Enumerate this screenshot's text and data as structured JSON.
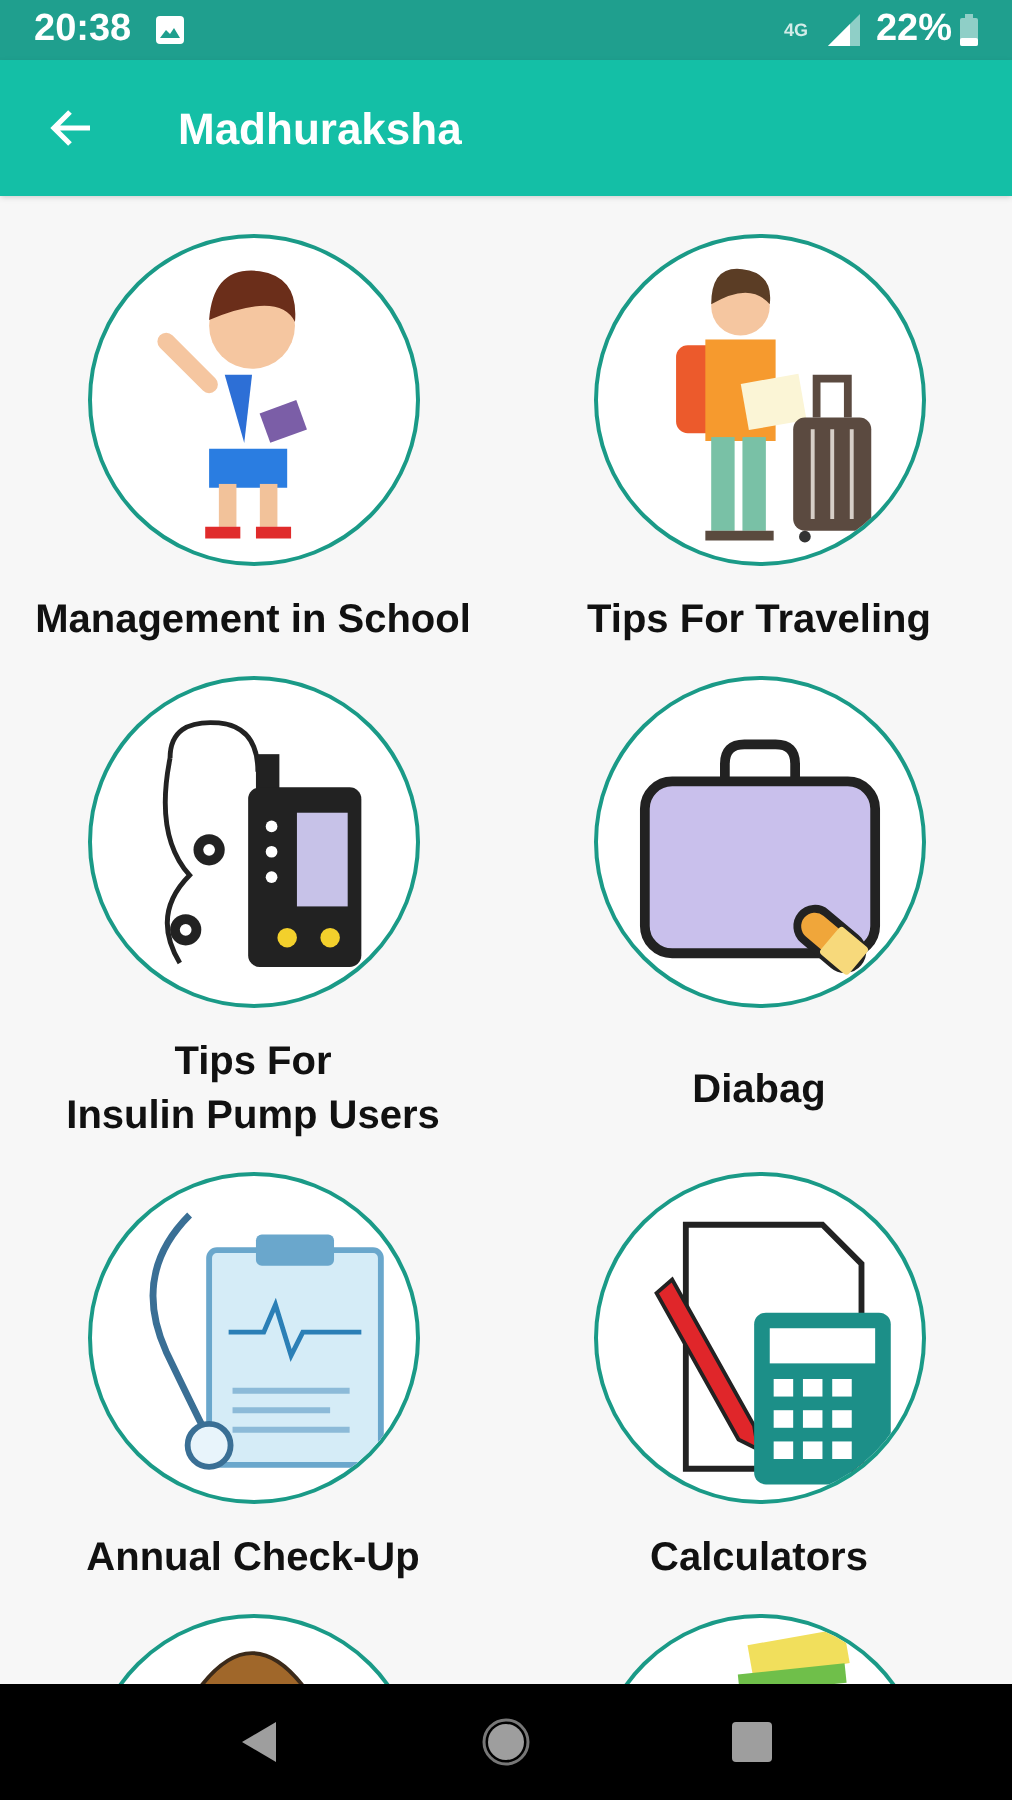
{
  "status_bar": {
    "time": "20:38",
    "network": "4G",
    "battery": "22%"
  },
  "app_bar": {
    "title": "Madhuraksha"
  },
  "tiles": [
    {
      "label": "Management in School"
    },
    {
      "label": "Tips For Traveling"
    },
    {
      "label": "Tips For\nInsulin Pump Users"
    },
    {
      "label": "Diabag"
    },
    {
      "label": "Annual Check-Up"
    },
    {
      "label": "Calculators"
    }
  ]
}
